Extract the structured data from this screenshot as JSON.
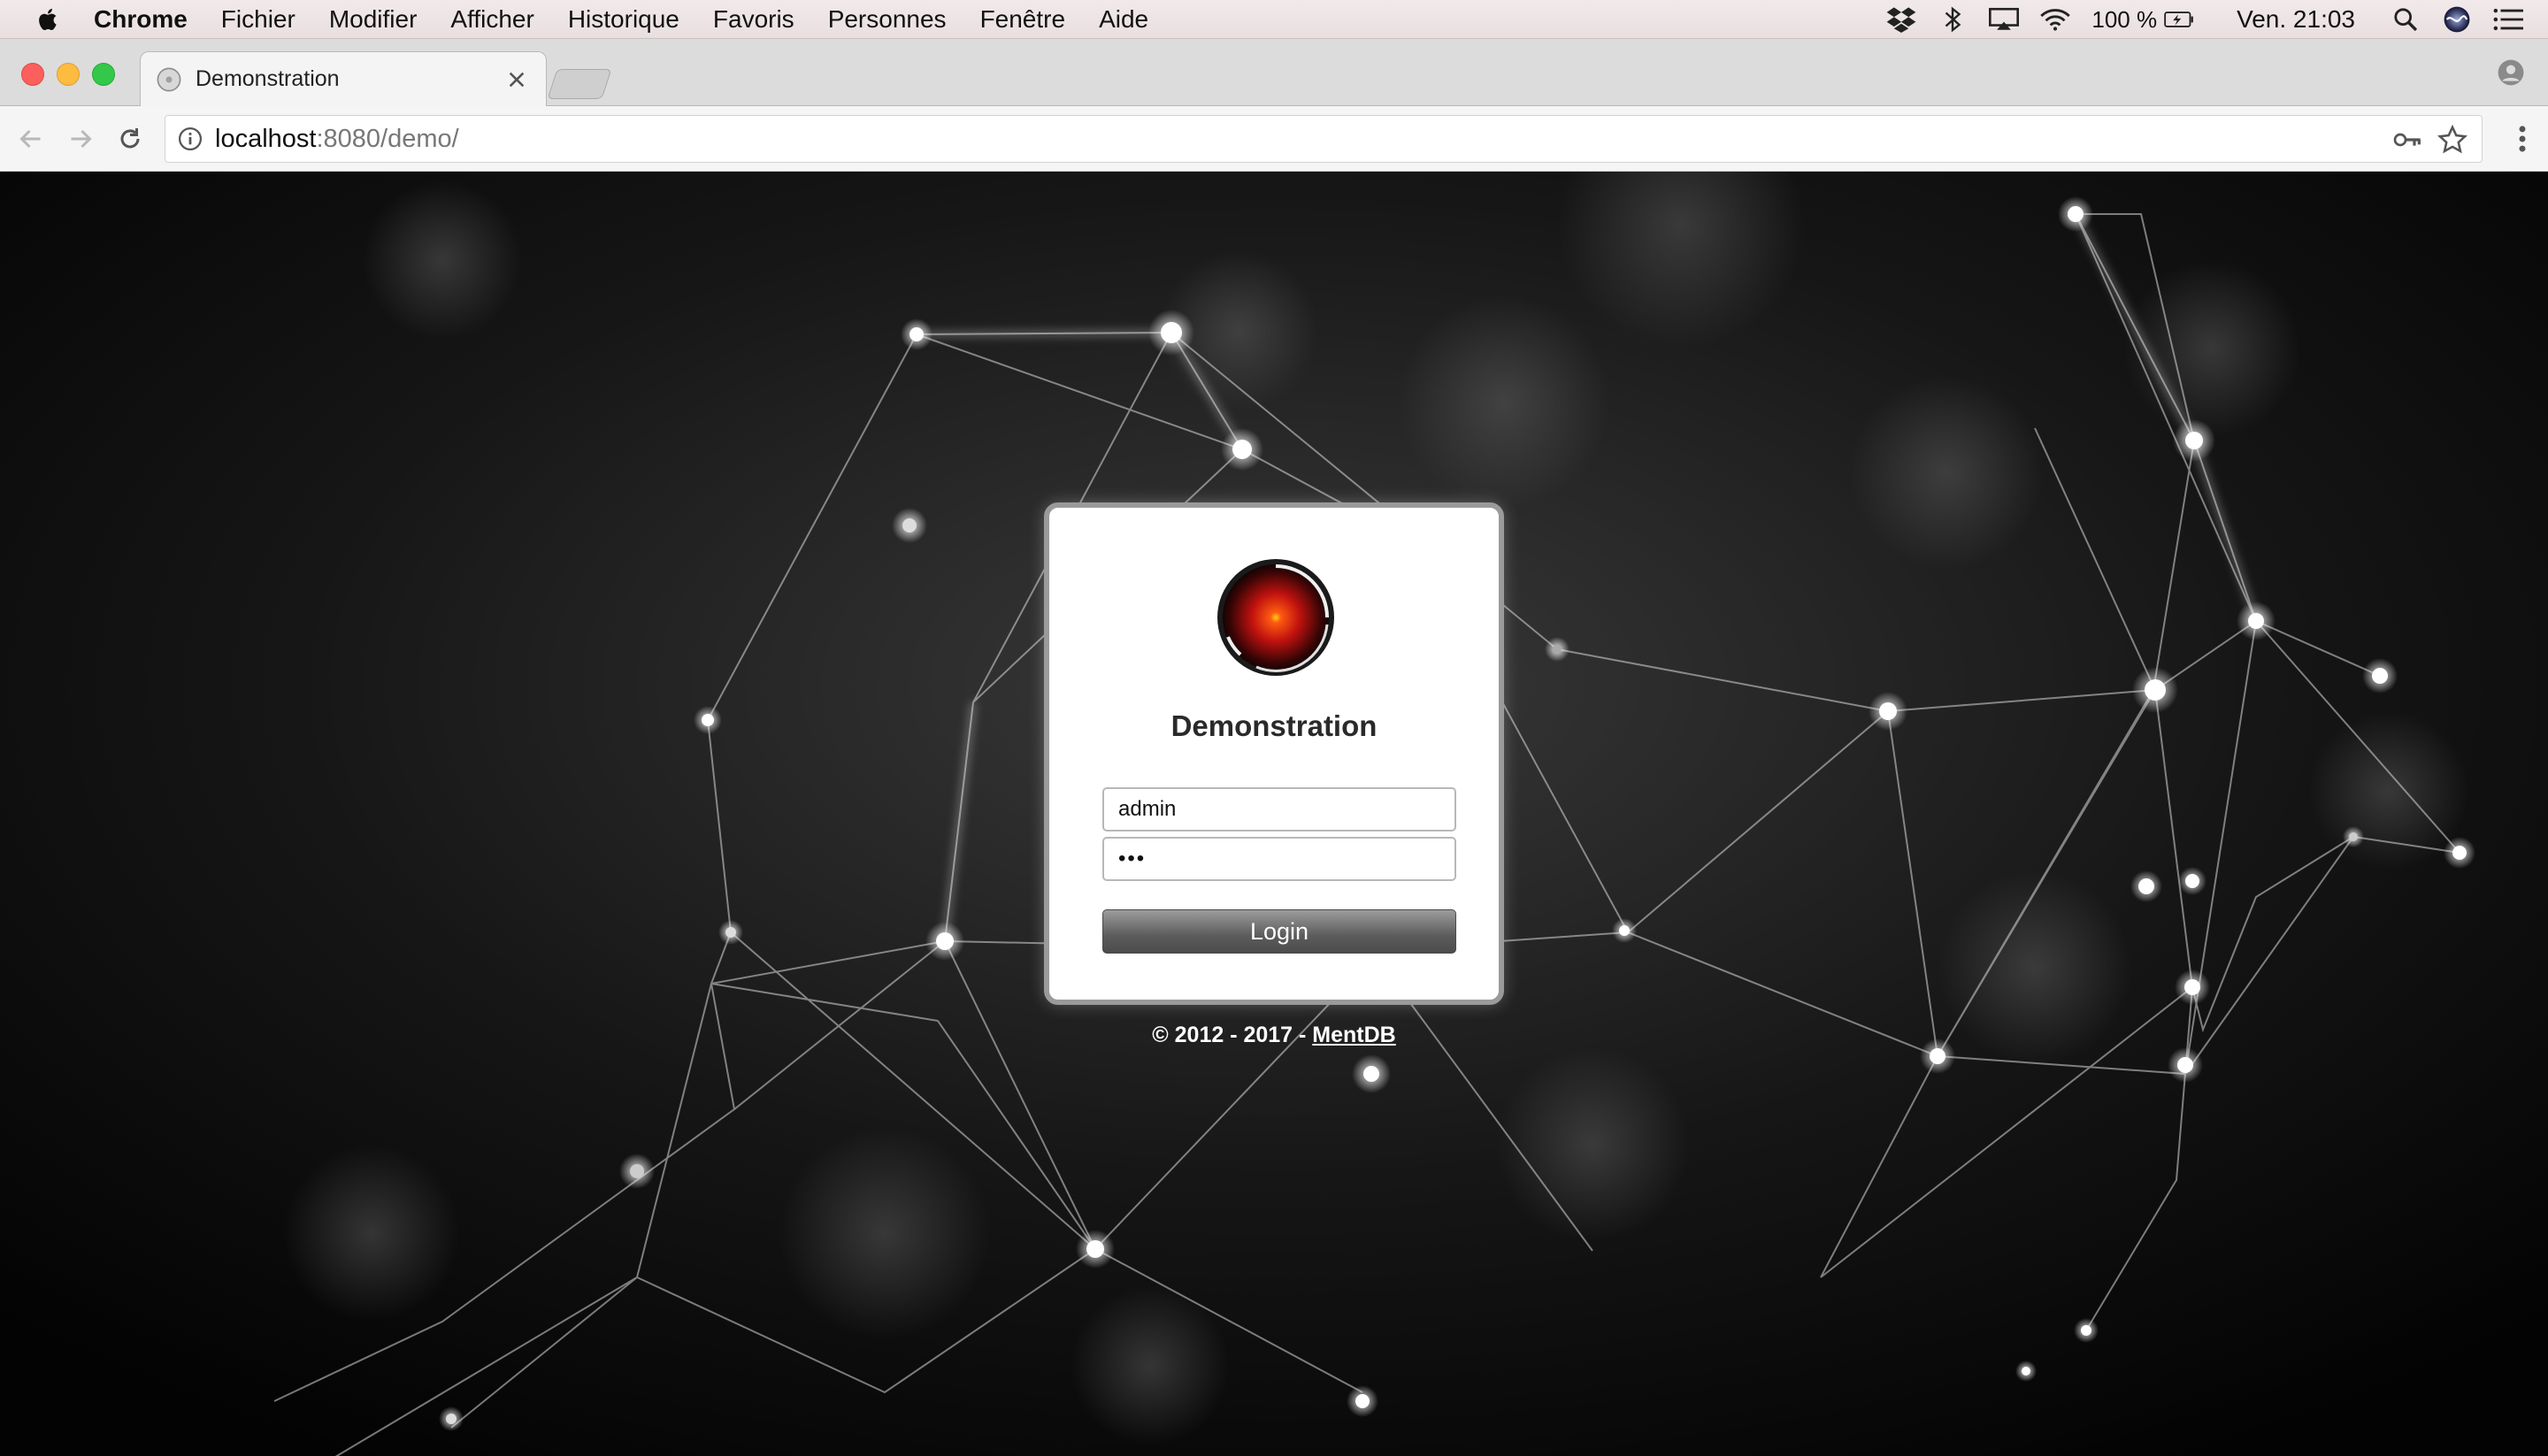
{
  "menubar": {
    "app_name": "Chrome",
    "items": [
      "Fichier",
      "Modifier",
      "Afficher",
      "Historique",
      "Favoris",
      "Personnes",
      "Fenêtre",
      "Aide"
    ],
    "battery": "100 %",
    "clock": "Ven. 21:03"
  },
  "tab": {
    "title": "Demonstration"
  },
  "address_bar": {
    "host": "localhost",
    "rest": ":8080/demo/"
  },
  "login": {
    "title": "Demonstration",
    "username_value": "admin",
    "password_value": "•••",
    "button_label": "Login"
  },
  "footer": {
    "copyright": "© 2012 - 2017 - ",
    "link_text": "MentDB"
  },
  "colors": {
    "logo_core": "#e0201a",
    "button": "#5c5c5c"
  }
}
